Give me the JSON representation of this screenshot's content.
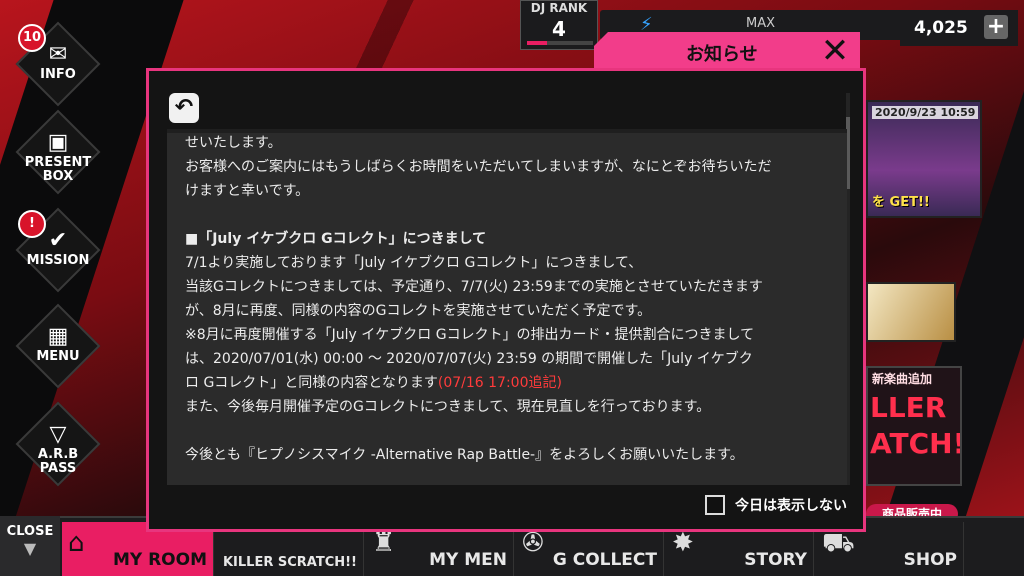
{
  "header": {
    "dj_rank_label": "DJ RANK",
    "dj_rank_value": "4",
    "dj_rank_progress": 0.3,
    "stamina_max_label": "MAX",
    "currency_amount": "4,025"
  },
  "sidebar": {
    "info": {
      "label": "INFO",
      "badge": "10"
    },
    "present": {
      "line1": "PRESENT",
      "line2": "BOX"
    },
    "mission": {
      "label": "MISSION",
      "badge": "!"
    },
    "menu": {
      "label": "MENU"
    },
    "pass": {
      "line1": "A.R.B",
      "line2": "PASS"
    }
  },
  "right_panel": {
    "event_date": "2020/9/23 10:59",
    "event_cta": "を GET!!",
    "song_tag": "新楽曲追加",
    "song_title_1": "LLER",
    "song_title_2": "ATCH!!",
    "sale": "商品販売中"
  },
  "bottom_nav": {
    "close_label": "CLOSE",
    "items": [
      {
        "label": "MY ROOM"
      },
      {
        "label": "KILLER SCRATCH!!"
      },
      {
        "label": "MY MEN"
      },
      {
        "label": "G COLLECT"
      },
      {
        "label": "STORY"
      },
      {
        "label": "SHOP"
      }
    ]
  },
  "notice": {
    "tab_title": "お知らせ",
    "back_icon": "undo-arrow-icon",
    "lines": [
      "せいたします。",
      "お客様へのご案内にはもうしばらくお時間をいただいてしまいますが、なにとぞお待ちいただ",
      "けますと幸いです。",
      "■「July イケブクロ Gコレクト」につきまして",
      "7/1より実施しております「July イケブクロ Gコレクト」につきまして、",
      "当該Gコレクトにつきましては、予定通り、7/7(火) 23:59までの実施とさせていただきます",
      "が、8月に再度、同様の内容のGコレクトを実施させていただく予定です。",
      "※8月に再度開催する「July イケブクロ Gコレクト」の排出カード・提供割合につきまして",
      "は、2020/07/01(水) 00:00 〜 2020/07/07(火) 23:59 の期間で開催した「July イケブク",
      "ロ Gコレクト」と同様の内容となります",
      "また、今後毎月開催予定のGコレクトにつきまして、現在見直しを行っております。",
      "今後とも『ヒプノシスマイク -Alternative Rap Battle-』をよろしくお願いいたします。"
    ],
    "red_note": "(07/16 17:00追記)",
    "hide_today_label": "今日は表示しない"
  },
  "colors": {
    "accent_pink": "#e8357e",
    "tab_pink": "#f23d8a",
    "red_note": "#ff3b3b",
    "nav_active": "#e91e63"
  }
}
